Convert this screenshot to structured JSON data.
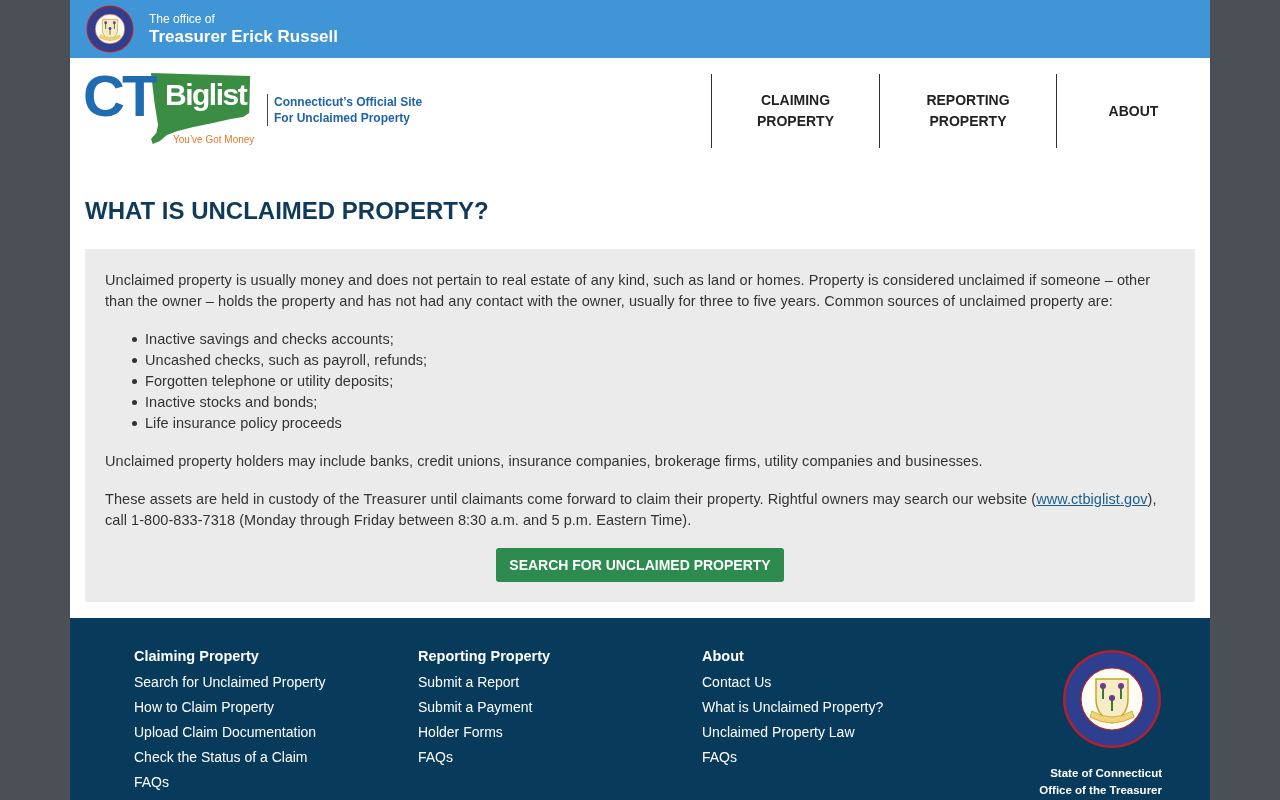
{
  "top_bar": {
    "overline": "The office of",
    "title": "Treasurer Erick Russell"
  },
  "header": {
    "logo": {
      "letters": "CT",
      "wordmark": "Biglist",
      "slogan": "You’ve Got Money"
    },
    "tagline": [
      "Connecticut’s Official Site",
      "For Unclaimed Property"
    ],
    "nav": [
      {
        "label": "CLAIMING PROPERTY"
      },
      {
        "label": "REPORTING PROPERTY"
      },
      {
        "label": "ABOUT"
      }
    ]
  },
  "main": {
    "heading": "WHAT IS UNCLAIMED PROPERTY?",
    "intro": "Unclaimed property is usually money and does not pertain to real estate of any kind, such as land or homes. Property is considered unclaimed if someone – other than the owner – holds the property and has not had any contact with the owner, usually for three to five years. Common sources of unclaimed property are:",
    "sources": [
      "Inactive savings and checks accounts;",
      "Uncashed checks, such as payroll, refunds;",
      "Forgotten telephone or utility deposits;",
      "Inactive stocks and bonds;",
      "Life insurance policy proceeds"
    ],
    "holders": "Unclaimed property holders may include banks, credit unions, insurance companies, brokerage firms, utility companies and businesses.",
    "contact": {
      "before": "These assets are held in custody of the Treasurer until claimants come forward to claim their property. Rightful owners may search our website (",
      "link": "www.ctbiglist.gov",
      "after": "), call 1-800-833-7318 (Monday through Friday between 8:30 a.m. and 5 p.m. Eastern Time)."
    },
    "button": "SEARCH FOR UNCLAIMED PROPERTY"
  },
  "footer": {
    "columns": [
      {
        "heading": "Claiming Property",
        "links": [
          "Search for Unclaimed Property",
          "How to Claim Property",
          "Upload Claim Documentation",
          "Check the Status of a Claim",
          "FAQs"
        ]
      },
      {
        "heading": "Reporting Property",
        "links": [
          "Submit a Report",
          "Submit a Payment",
          "Holder Forms",
          "FAQs"
        ]
      },
      {
        "heading": "About",
        "links": [
          "Contact Us",
          "What is Unclaimed Property?",
          "Unclaimed Property Law",
          "FAQs"
        ]
      }
    ],
    "caption": [
      "State of Connecticut",
      "Office of the Treasurer"
    ]
  }
}
